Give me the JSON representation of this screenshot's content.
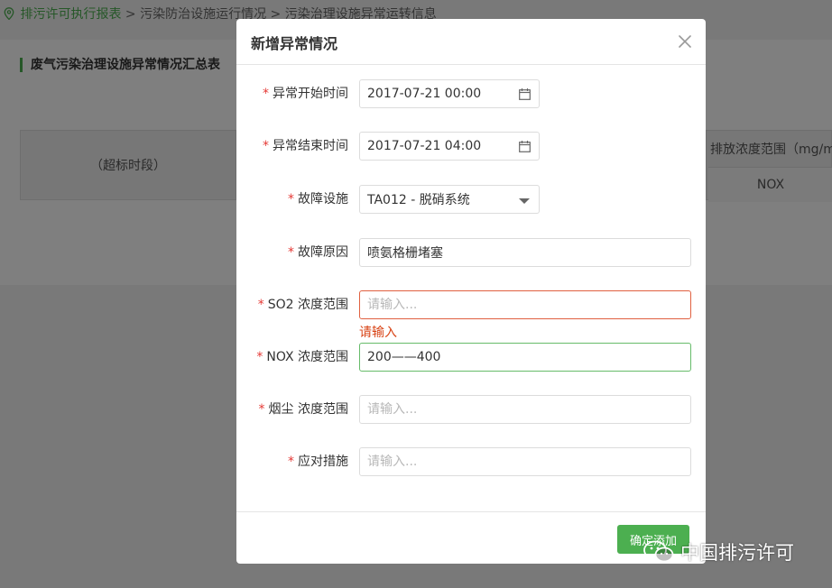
{
  "breadcrumb": {
    "home": "排污许可执行报表",
    "sep1": " > ",
    "level2": "污染防治设施运行情况",
    "sep2": " > ",
    "level3": "污染治理设施异常运转信息"
  },
  "panel": {
    "title": "废气污染治理设施异常情况汇总表",
    "table": {
      "left_header": "（超标时段）",
      "range_header": "排放浓度范围（mg/m",
      "nox_header": "NOX"
    }
  },
  "modal": {
    "title": "新增异常情况",
    "fields": [
      {
        "label": "异常开始时间",
        "value": "2017-07-21 00:00",
        "placeholder": ""
      },
      {
        "label": "异常结束时间",
        "value": "2017-07-21 04:00",
        "placeholder": ""
      },
      {
        "label": "故障设施",
        "value": "TA012 - 脱硝系统",
        "placeholder": ""
      },
      {
        "label": "故障原因",
        "value": "喷氨格栅堵塞",
        "placeholder": ""
      },
      {
        "label": "SO2 浓度范围",
        "value": "",
        "placeholder": "请输入..."
      },
      {
        "label": "NOX 浓度范围",
        "value": "200——400",
        "placeholder": ""
      },
      {
        "label": "烟尘 浓度范围",
        "value": "",
        "placeholder": "请输入..."
      },
      {
        "label": "应对措施",
        "value": "",
        "placeholder": "请输入..."
      }
    ],
    "required_mark": "*",
    "so2_error": "请输入",
    "confirm_label": "确定添加"
  },
  "watermark": {
    "text": "中国排污许可"
  },
  "colors": {
    "accent_green": "#4caf50",
    "error_red": "#e06040",
    "required_red": "#e53935"
  }
}
